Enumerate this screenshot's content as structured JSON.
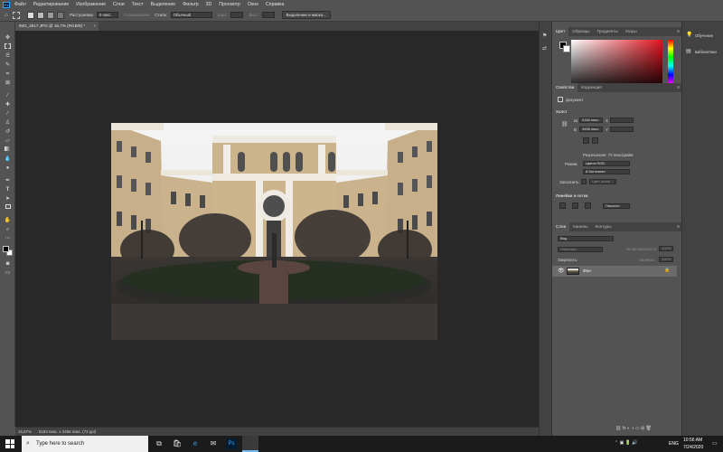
{
  "menubar": {
    "app_logo": "Ps",
    "items": [
      "Файл",
      "Редактирование",
      "Изображение",
      "Слои",
      "Текст",
      "Выделение",
      "Фильтр",
      "3D",
      "Просмотр",
      "Окно",
      "Справка"
    ]
  },
  "optionsbar": {
    "feather_label": "Растушевка:",
    "feather_value": "0 пикс.",
    "antialias_label": "Сглаживание",
    "style_label": "Стиль:",
    "style_value": "Обычный",
    "width_label": "Шир.:",
    "height_label": "Выс.:",
    "select_mask_button": "Выделение и маска..."
  },
  "document": {
    "tab_title": "IMG_4917.JPG @ 16,7% (RGB/8) *",
    "close_glyph": "×"
  },
  "statusbar": {
    "zoom": "16,67%",
    "doc_info": "5184 пикс. x 3456 пикс. (72 ppi)"
  },
  "color_panel": {
    "tabs": [
      "Цвет",
      "Образцы",
      "Градиенты",
      "Узоры"
    ],
    "active_tab": "Цвет",
    "base_hue": "#e0141f"
  },
  "properties_panel": {
    "tabs": [
      "Свойства",
      "Коррекция"
    ],
    "doc_label": "Документ",
    "canvas_header": "Холст",
    "w_label": "Ш",
    "w_value": "5184 пикс.",
    "h_label": "В",
    "h_value": "3456 пикс.",
    "x_label": "X",
    "y_label": "Y",
    "resolution": "Разрешение: 72 пикс/дюйм",
    "mode_label": "Режим",
    "mode_value": "Цвета RGB",
    "depth_value": "8 бит/канал",
    "fill_label": "Заполнить",
    "fill_value": "Цвет фона",
    "rulers_header": "Линейки и сетки",
    "units_value": "Пиксели"
  },
  "layers_panel": {
    "tabs": [
      "Слои",
      "Каналы",
      "Контуры"
    ],
    "search_placeholder": "Вид",
    "blend_mode": "Обычные",
    "opacity_label": "Непрозрачность:",
    "opacity_value": "100%",
    "lock_label": "Закрепить:",
    "fill_label": "Заливка:",
    "fill_value": "100%",
    "layer_name": "Фон"
  },
  "side_panel": {
    "learn": "Обучение",
    "libraries": "Библиотеки"
  },
  "taskbar": {
    "search_placeholder": "Type here to search",
    "language": "ENG",
    "time": "10:56 AM",
    "date": "7/24/2020"
  }
}
